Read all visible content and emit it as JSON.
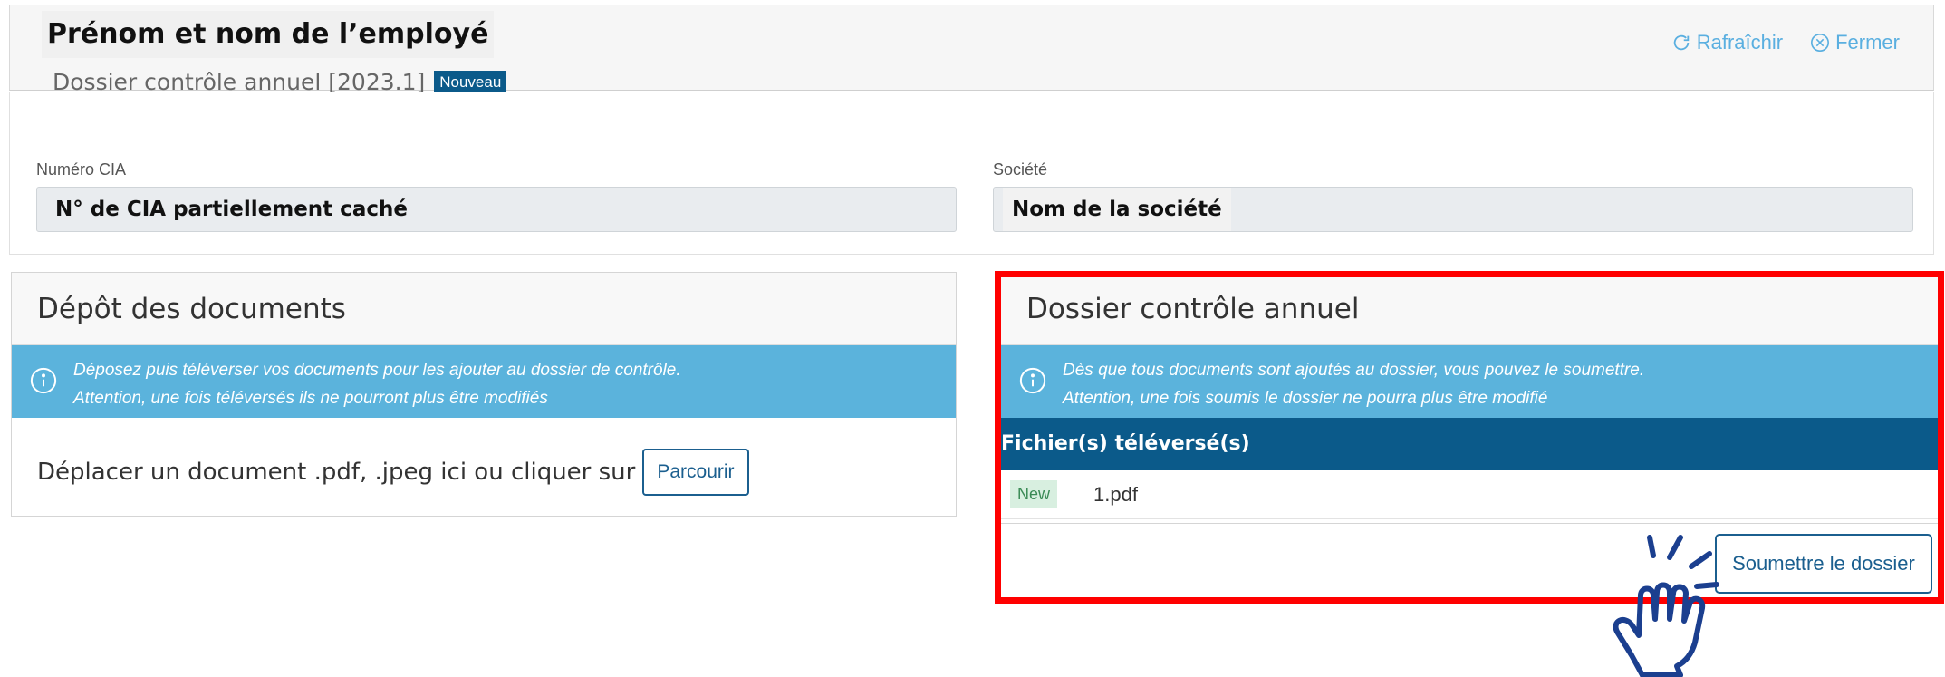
{
  "header": {
    "employee_name": "Prénom et nom de l’employé",
    "dossier_title": "Dossier contrôle annuel [2023.1]",
    "status_badge": "Nouveau",
    "refresh_label": "Rafraîchir",
    "close_label": "Fermer"
  },
  "fields": {
    "cia_label": "Numéro CIA",
    "cia_value": "N° de CIA partiellement caché",
    "company_label": "Société",
    "company_value": "Nom de la société"
  },
  "upload_card": {
    "title": "Dépôt des documents",
    "info_line1": "Déposez puis téléverser vos documents pour les ajouter au dossier de contrôle.",
    "info_line2": "Attention, une fois téléversés ils ne pourront plus être modifiés",
    "drop_text": "Déplacer un document .pdf, .jpeg ici ou cliquer sur",
    "browse_label": "Parcourir"
  },
  "dossier_card": {
    "title": "Dossier contrôle annuel",
    "info_line1": "Dès que tous documents sont ajoutés au dossier, vous pouvez le soumettre.",
    "info_line2": "Attention, une fois soumis le dossier ne pourra plus être modifié",
    "files_header": "Fichier(s) téléversé(s)",
    "files": [
      {
        "badge": "New",
        "name": "1.pdf"
      }
    ],
    "submit_label": "Soumettre le dossier"
  },
  "colors": {
    "accent": "#0b5a8a",
    "info": "#5bb3dc",
    "highlight": "#ff0000",
    "link": "#5aafe0"
  },
  "icons": [
    "refresh-icon",
    "close-circle-icon",
    "info-icon",
    "pointing-hand-icon"
  ]
}
